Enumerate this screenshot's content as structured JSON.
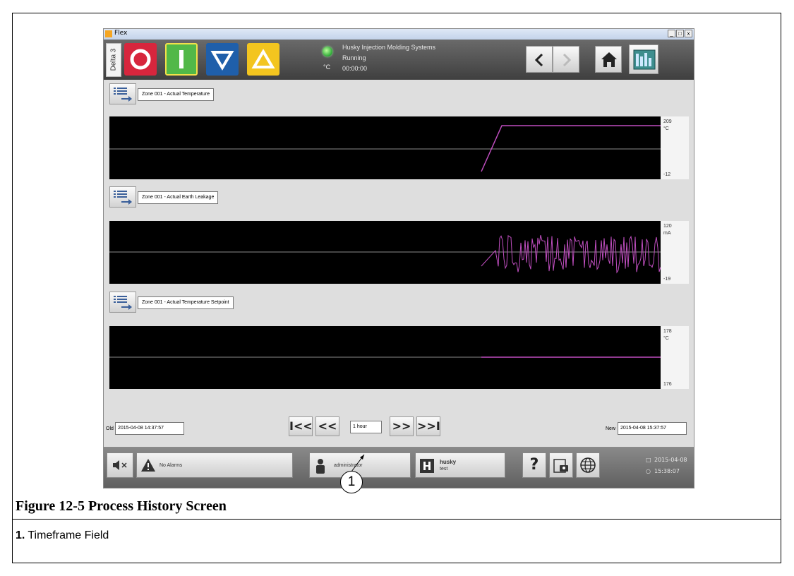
{
  "window": {
    "title": "Flex",
    "min": "_",
    "max": "□",
    "close": "x"
  },
  "header": {
    "machine_tab": "Delta 3",
    "status": {
      "company": "Husky Injection Molding Systems",
      "state": "Running",
      "time": "00:00:00",
      "unit": "°C",
      "led_color": "#3cb043"
    },
    "tiles": [
      {
        "name": "stop",
        "color": "#d7263d"
      },
      {
        "name": "run",
        "color": "#52b848"
      },
      {
        "name": "down",
        "color": "#1f5faa"
      },
      {
        "name": "up",
        "color": "#f3c51f"
      }
    ]
  },
  "charts": [
    {
      "label": "Zone 001 - Actual Temperature",
      "max": "209",
      "unit": "°C",
      "min": "-12",
      "trace": "ramp"
    },
    {
      "label": "Zone 001 - Actual Earth Leakage",
      "max": "120",
      "unit": "mA",
      "min": "-19",
      "trace": "noise"
    },
    {
      "label": "Zone 001 - Actual Temperature Setpoint",
      "max": "178",
      "unit": "°C",
      "min": "176",
      "trace": "flat"
    }
  ],
  "footer": {
    "old_label": "Old",
    "old_value": "2015-04-08 14:37:57",
    "timeframe": "1 hour",
    "new_label": "New",
    "new_value": "2015-04-08 15:37:57",
    "first": "I<<",
    "prev": "<<",
    "next": ">>",
    "last": ">>I"
  },
  "bottombar": {
    "alarms": "No Alarms",
    "user": "administrator",
    "machine": "husky",
    "machine_sub": "test",
    "help": "?",
    "date": "2015-04-08",
    "time": "15:38:07"
  },
  "figure": {
    "title": "Figure 12-5  Process History Screen",
    "callout_number": "1",
    "caption_number": "1.",
    "caption_text": "Timeframe Field"
  },
  "colors": {
    "trace": "#c04ec0",
    "midline": "#8a8a8a"
  }
}
